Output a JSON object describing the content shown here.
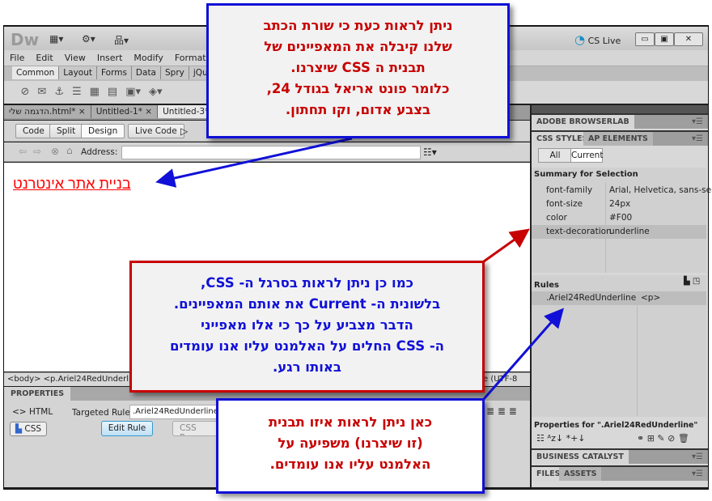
{
  "app": {
    "logo": "Dw",
    "cs_live": "CS Live"
  },
  "menu": [
    "File",
    "Edit",
    "View",
    "Insert",
    "Modify",
    "Format"
  ],
  "insert_tabs": [
    "Common",
    "Layout",
    "Forms",
    "Data",
    "Spry",
    "jQuery"
  ],
  "doc_tabs": [
    {
      "label": "הדגמה שלי.html*",
      "close": "×"
    },
    {
      "label": "Untitled-1*",
      "close": "×"
    },
    {
      "label": "Untitled-3*",
      "close": ""
    }
  ],
  "view_buttons": {
    "code": "Code",
    "split": "Split",
    "design": "Design",
    "live_code": "Live Code"
  },
  "address": {
    "label": "Address:",
    "value": ""
  },
  "design": {
    "text": "בניית אתר אינטרנט",
    "text_color": "#FF0000"
  },
  "tag_selector": {
    "path": "<body> <p.Ariel24RedUnderline>",
    "encoding": "e (UTF-8"
  },
  "properties": {
    "title": "PROPERTIES",
    "html": "HTML",
    "css": "CSS",
    "targeted_rule_label": "Targeted Rule",
    "targeted_rule": ".Ariel24RedUnderline",
    "edit_rule": "Edit Rule",
    "css_panel": "CSS Pan"
  },
  "right_panel": {
    "browserlab": "ADOBE BROWSERLAB",
    "css_styles": "CSS STYLES",
    "ap_elements": "AP ELEMENTS",
    "all": "All",
    "current": "Current",
    "summary_title": "Summary for Selection",
    "summary": [
      {
        "prop": "font-family",
        "value": "Arial, Helvetica, sans-serif"
      },
      {
        "prop": "font-size",
        "value": "24px"
      },
      {
        "prop": "color",
        "value": "#F00"
      },
      {
        "prop": "text-decoration",
        "value": "underline"
      }
    ],
    "rules_title": "Rules",
    "rules": [
      {
        "selector": ".Ariel24RedUnderline",
        "tag": "<p>"
      }
    ],
    "properties_for": "Properties for \".Ariel24RedUnderline\"",
    "business_catalyst": "BUSINESS CATALYST",
    "files": "FILES",
    "assets": "ASSETS"
  },
  "callouts": {
    "top": [
      "ניתן לראות כעת כי שורת הכתב",
      "שלנו קיבלה את המאפיינים של",
      "תבנית ה CSS שיצרנו.",
      "כלומר פונט אריאל בגודל 24,",
      "בצבע אדום, וקו תחתון."
    ],
    "middle": [
      "כמו כן ניתן לראות בסרגל ה- CSS,",
      "בלשונית ה- Current את אותם המאפיינים.",
      "הדבר מצביע על כך כי אלו מאפייני",
      "ה- CSS החלים על האלמנט עליו אנו עומדים",
      "באותו רגע."
    ],
    "bottom": [
      "כאן ניתן לראות איזו תבנית",
      "(זו שיצרנו) משפיעה על",
      "האלמנט עליו אנו עומדים."
    ]
  },
  "colors": {
    "callout_blue": "#1010D8",
    "callout_red": "#C80000"
  }
}
